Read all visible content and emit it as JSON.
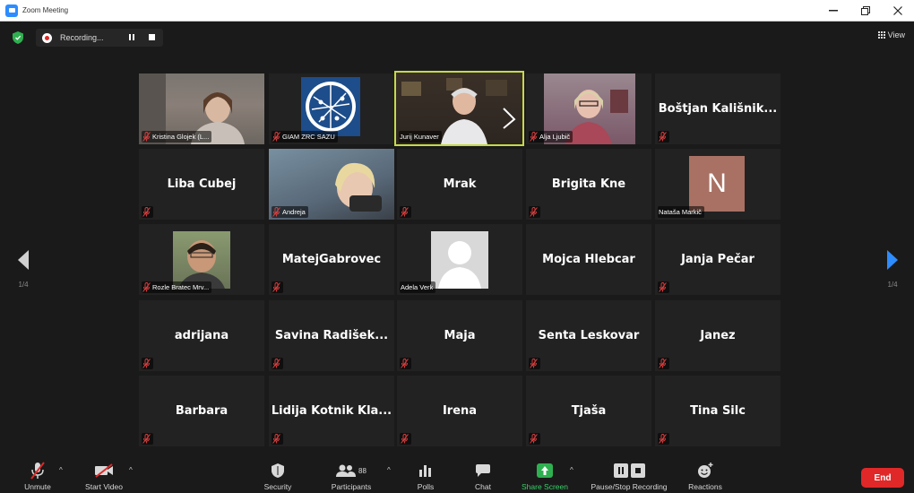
{
  "window": {
    "title": "Zoom Meeting"
  },
  "top": {
    "recording_label": "Recording...",
    "view_label": "View"
  },
  "nav": {
    "left_page": "1/4",
    "right_page": "1/4"
  },
  "participants": [
    {
      "name": "Kristina Glojek (L...",
      "type": "video"
    },
    {
      "name": "GIAM ZRC SAZU",
      "type": "logo"
    },
    {
      "name": "Jurij Kunaver",
      "type": "video",
      "active": true
    },
    {
      "name": "Alja Ljubič",
      "type": "video"
    },
    {
      "name": "Boštjan Kališnik...",
      "type": "name"
    },
    {
      "name": "Liba Čubej",
      "type": "name"
    },
    {
      "name": "Andreja",
      "type": "video"
    },
    {
      "name": "Mrak",
      "type": "name"
    },
    {
      "name": "Brigita Kne",
      "type": "name"
    },
    {
      "name": "Nataša Markič",
      "type": "avatar",
      "initial": "N"
    },
    {
      "name": "Rozle Bratec Mrv...",
      "type": "photo"
    },
    {
      "name": "MatejGabrovec",
      "type": "name"
    },
    {
      "name": "Adela Verk",
      "type": "placeholder"
    },
    {
      "name": "Mojca Hlebcar",
      "type": "name"
    },
    {
      "name": "Janja Pečar",
      "type": "name"
    },
    {
      "name": "adrijana",
      "type": "name"
    },
    {
      "name": "Savina Radišek...",
      "type": "name"
    },
    {
      "name": "Maja",
      "type": "name"
    },
    {
      "name": "Senta Leskovar",
      "type": "name"
    },
    {
      "name": "Janez",
      "type": "name"
    },
    {
      "name": "Barbara",
      "type": "name"
    },
    {
      "name": "Lidija Kotnik Kla...",
      "type": "name"
    },
    {
      "name": "Irena",
      "type": "name"
    },
    {
      "name": "Tjaša",
      "type": "name"
    },
    {
      "name": "Tina Šilc",
      "type": "name"
    }
  ],
  "toolbar": {
    "unmute": "Unmute",
    "start_video": "Start Video",
    "security": "Security",
    "participants": "Participants",
    "participants_count": "88",
    "polls": "Polls",
    "chat": "Chat",
    "share_screen": "Share Screen",
    "pause_stop_recording": "Pause/Stop Recording",
    "reactions": "Reactions",
    "end": "End"
  },
  "colors": {
    "accent_green": "#3ad16a",
    "active_border": "#c5d94a",
    "end_red": "#e02828",
    "avatar_bg": "#a87163"
  }
}
